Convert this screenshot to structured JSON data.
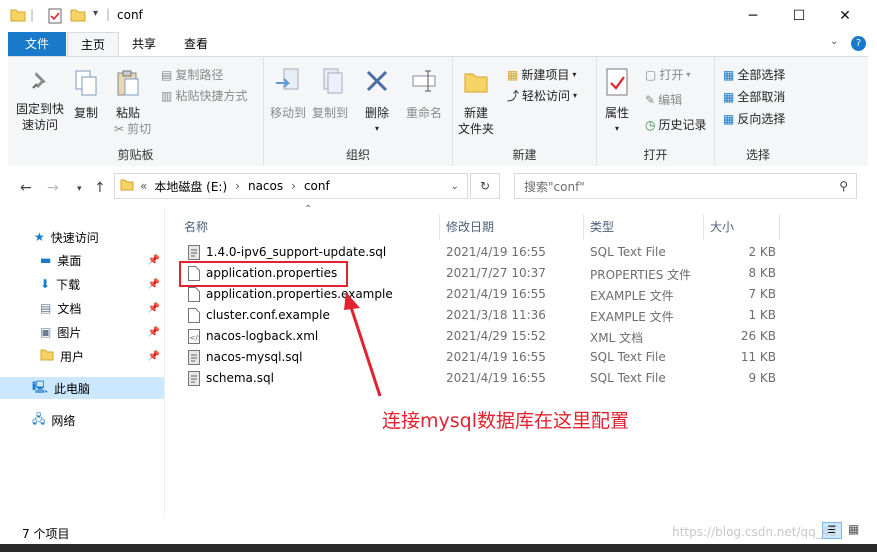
{
  "window": {
    "title": "conf"
  },
  "tabs": {
    "file": "文件",
    "home": "主页",
    "share": "共享",
    "view": "查看"
  },
  "ribbon": {
    "clipboard": {
      "label": "剪贴板",
      "pin_quick": "固定到快速访问",
      "pin_quick_1": "固定到快",
      "pin_quick_2": "速访问",
      "copy": "复制",
      "paste": "粘贴",
      "copy_path": "复制路径",
      "paste_shortcut": "粘贴快捷方式",
      "cut": "剪切"
    },
    "organize": {
      "label": "组织",
      "move_to": "移动到",
      "copy_to": "复制到",
      "delete": "删除",
      "rename": "重命名"
    },
    "new": {
      "label": "新建",
      "new_folder_1": "新建",
      "new_folder_2": "文件夹",
      "new_item": "新建项目",
      "easy_access": "轻松访问"
    },
    "open": {
      "label": "打开",
      "properties": "属性",
      "open": "打开",
      "edit": "编辑",
      "history": "历史记录"
    },
    "select": {
      "label": "选择",
      "select_all": "全部选择",
      "select_none": "全部取消",
      "invert": "反向选择"
    }
  },
  "address": {
    "sep": "«",
    "drive": "本地磁盘 (E:)",
    "folder1": "nacos",
    "folder2": "conf",
    "chevron": "›"
  },
  "search": {
    "placeholder": "搜索\"conf\""
  },
  "nav": {
    "quick": "快速访问",
    "desktop": "桌面",
    "downloads": "下载",
    "documents": "文档",
    "pictures": "图片",
    "users": "用户",
    "this_pc": "此电脑",
    "network": "网络"
  },
  "columns": {
    "name": "名称",
    "date": "修改日期",
    "type": "类型",
    "size": "大小"
  },
  "files": [
    {
      "name": "1.4.0-ipv6_support-update.sql",
      "date": "2021/4/19 16:55",
      "type": "SQL Text File",
      "size": "2 KB"
    },
    {
      "name": "application.properties",
      "date": "2021/7/27 10:37",
      "type": "PROPERTIES 文件",
      "size": "8 KB"
    },
    {
      "name": "application.properties.example",
      "date": "2021/4/19 16:55",
      "type": "EXAMPLE 文件",
      "size": "7 KB"
    },
    {
      "name": "cluster.conf.example",
      "date": "2021/3/18 11:36",
      "type": "EXAMPLE 文件",
      "size": "1 KB"
    },
    {
      "name": "nacos-logback.xml",
      "date": "2021/4/29 15:52",
      "type": "XML 文档",
      "size": "26 KB"
    },
    {
      "name": "nacos-mysql.sql",
      "date": "2021/4/19 16:55",
      "type": "SQL Text File",
      "size": "11 KB"
    },
    {
      "name": "schema.sql",
      "date": "2021/4/19 16:55",
      "type": "SQL Text File",
      "size": "9 KB"
    }
  ],
  "annotation": "连接mysql数据库在这里配置",
  "status": {
    "count": "7 个项目"
  },
  "watermark": "https://blog.csdn.net/qq_43",
  "colors": {
    "accent": "#1979ca",
    "annotation": "#e0232e",
    "selection": "#cce8ff"
  }
}
